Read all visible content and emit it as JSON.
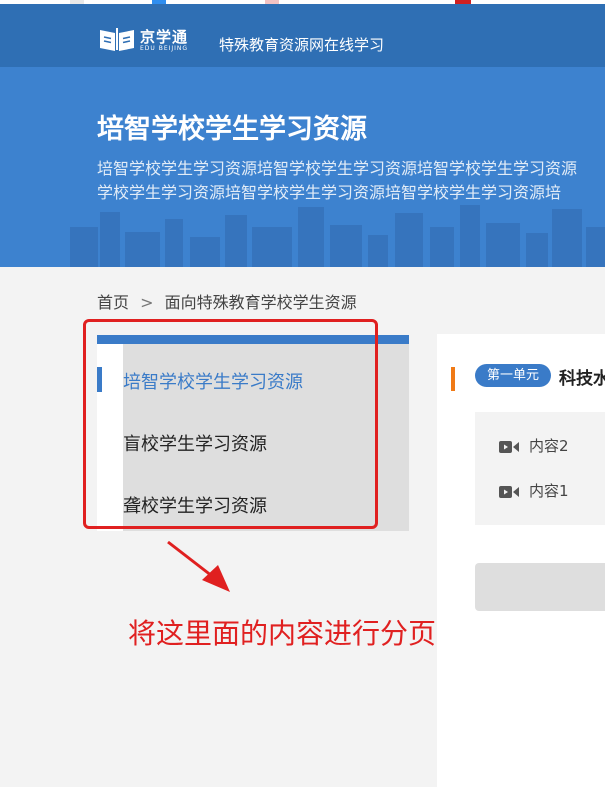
{
  "colors": {
    "nav": "#2f6fb4",
    "banner": "#3d82cf",
    "accent": "#3a7bc8",
    "annotation": "#e02020",
    "unit_bar": "#f07a16"
  },
  "header": {
    "logo_cn": "京学通",
    "logo_en": "EDU BEIJING",
    "site_title": "特殊教育资源网在线学习"
  },
  "banner": {
    "title": "培智学校学生学习资源",
    "description_line1": "培智学校学生学习资源培智学校学生学习资源培智学校学生学习资源",
    "description_line2": "学校学生学习资源培智学校学生学习资源培智学校学生学习资源培"
  },
  "breadcrumb": {
    "home": "首页",
    "separator": ">",
    "current": "面向特殊教育学校学生资源"
  },
  "sidebar": {
    "items": [
      {
        "label": "培智学校学生学习资源",
        "active": true
      },
      {
        "label": "盲校学生学习资源",
        "active": false
      },
      {
        "label": "聋校学生学习资源",
        "active": false
      }
    ]
  },
  "annotation": {
    "text": "将这里面的内容进行分页"
  },
  "content": {
    "unit_badge": "第一单元",
    "unit_title": "科技水",
    "items": [
      {
        "label": "内容2",
        "icon": "video-icon"
      },
      {
        "label": "内容1",
        "icon": "video-icon"
      }
    ]
  }
}
